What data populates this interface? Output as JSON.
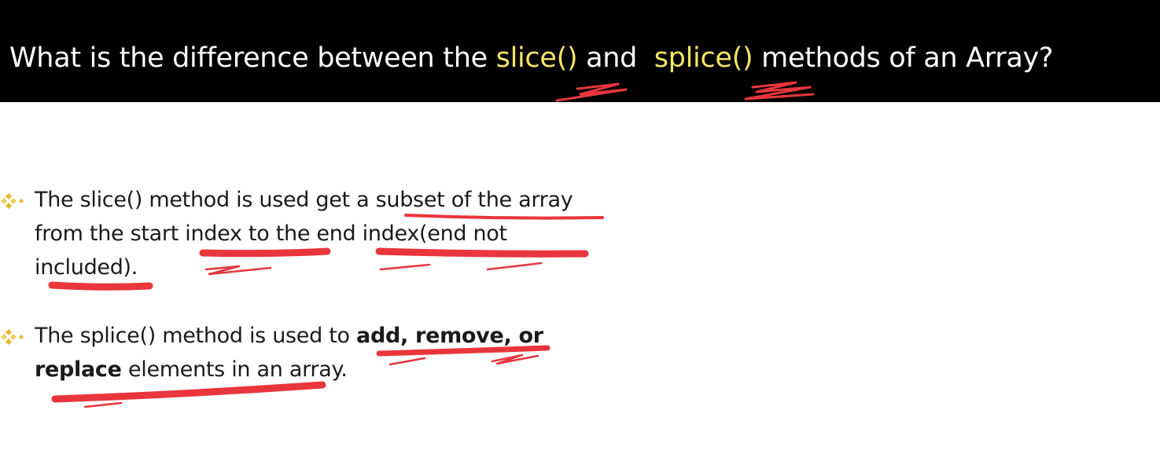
{
  "title": {
    "part1": "What is the difference between the ",
    "slice": "slice()",
    "part2": " and  ",
    "splice": "splice()",
    "part3": " methods of an Array?"
  },
  "bullets": [
    {
      "lines": [
        "The slice() method is used get a subset of the array",
        "from the start index to the end index(end not",
        "included)."
      ]
    },
    {
      "line1_normal": "The splice() method is used to ",
      "line1_bold": "add, remove, or",
      "line2_bold": "replace",
      "line2_normal": " elements in an array."
    }
  ],
  "colors": {
    "title_background": "#000000",
    "title_text": "#ffffff",
    "title_highlight": "#f5e663",
    "body_text": "#1a1a1a",
    "bullet_marker": "#e9b52b",
    "annotation_ink": "#e8363c"
  },
  "icons": {
    "bullet_marker": "four-diamond-bullet-icon"
  }
}
